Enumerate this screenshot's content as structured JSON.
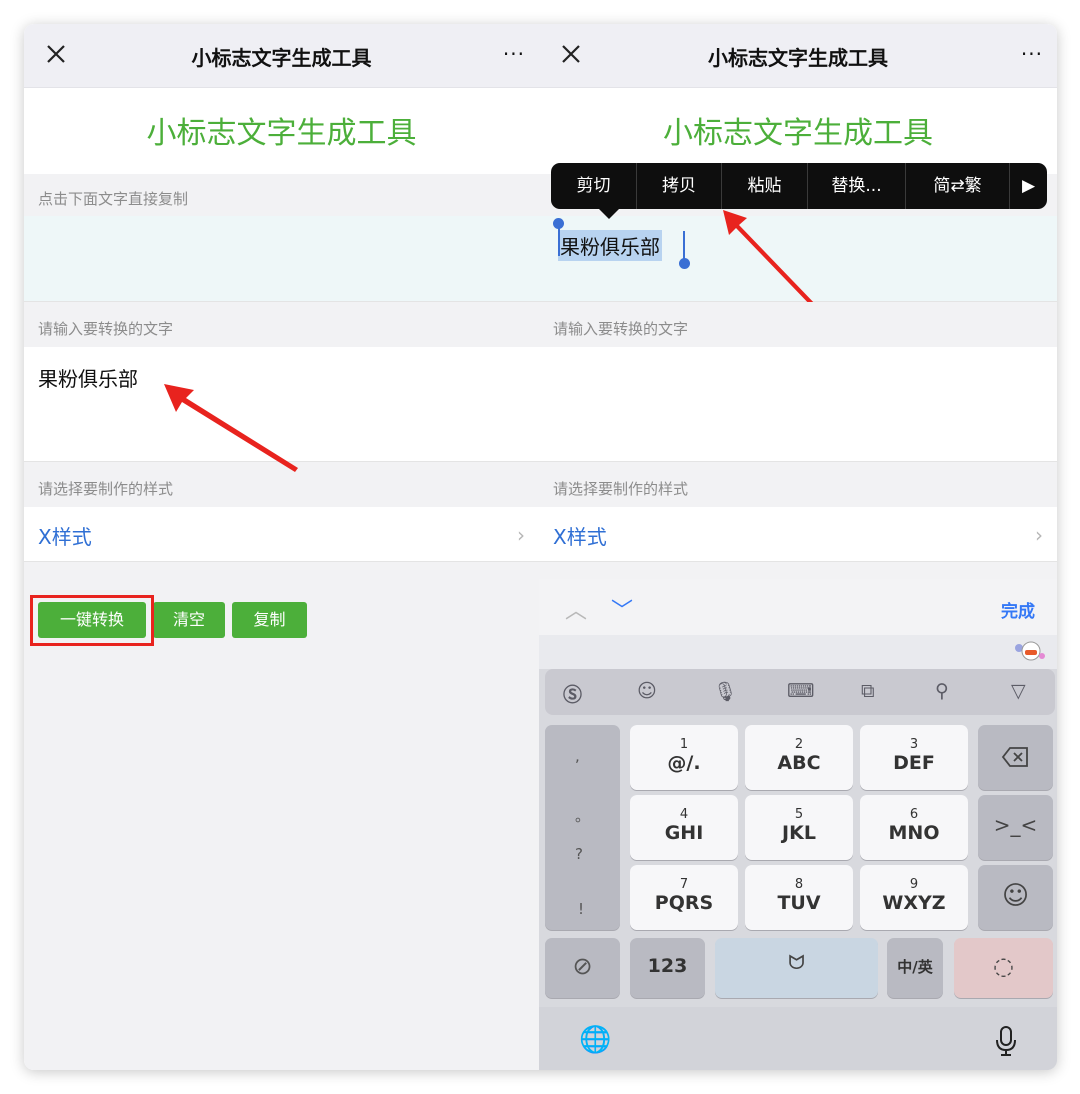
{
  "left": {
    "nav_title": "小标志文字生成工具",
    "nav_more": "···",
    "page_title": "小标志文字生成工具",
    "copy_hint": "点击下面文字直接复制",
    "input_label": "请输入要转换的文字",
    "input_value": "果粉俱乐部",
    "style_label": "请选择要制作的样式",
    "style_value": "X样式",
    "chevron": "›",
    "buttons": {
      "convert": "一键转换",
      "clear": "清空",
      "copy": "复制"
    }
  },
  "right": {
    "nav_title": "小标志文字生成工具",
    "nav_more": "···",
    "page_title": "小标志文字生成工具",
    "context_menu": [
      "剪切",
      "拷贝",
      "粘贴",
      "替换...",
      "简⇄繁",
      "▶"
    ],
    "selected_text": "果粉俱乐部",
    "input_label": "请输入要转换的文字",
    "style_label": "请选择要制作的样式",
    "style_value": "X样式",
    "chevron": "›",
    "keyboard": {
      "done": "完成",
      "left_column": [
        ",",
        "。",
        "?",
        "!"
      ],
      "keys": [
        {
          "num": "1",
          "letters": "@/."
        },
        {
          "num": "2",
          "letters": "ABC"
        },
        {
          "num": "3",
          "letters": "DEF"
        },
        {
          "num": "4",
          "letters": "GHI"
        },
        {
          "num": "5",
          "letters": "JKL"
        },
        {
          "num": "6",
          "letters": "MNO"
        },
        {
          "num": "7",
          "letters": "PQRS"
        },
        {
          "num": "8",
          "letters": "TUV"
        },
        {
          "num": "9",
          "letters": "WXYZ"
        }
      ],
      "key_123": "123",
      "key_lang": "中/英"
    }
  },
  "colors": {
    "green": "#4caf3a",
    "blue": "#2f6fd4",
    "red": "#e8231e",
    "selection": "#b8d3f0"
  }
}
